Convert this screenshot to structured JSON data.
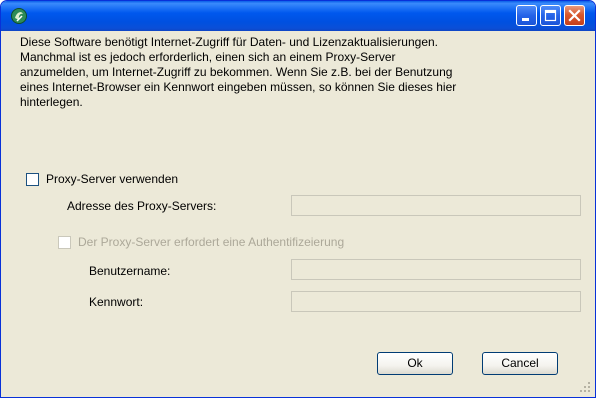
{
  "window": {
    "title": "",
    "controls": {
      "minimize_icon": "minimize-icon",
      "maximize_icon": "maximize-icon",
      "close_icon": "close-icon"
    }
  },
  "intro": {
    "lines": [
      "Diese Software benötigt Internet-Zugriff für Daten- und Lizenzaktualisierungen.",
      "Manchmal ist es jedoch erforderlich, einen sich an einem Proxy-Server",
      "anzumelden, um Internet-Zugriff zu bekommen. Wenn Sie z.B. bei der Benutzung",
      "eines Internet-Browser ein Kennwort eingeben müssen, so können Sie dieses hier",
      "hinterlegen."
    ]
  },
  "proxy": {
    "use_label": "Proxy-Server verwenden",
    "use_checked": false,
    "address_label": "Adresse des Proxy-Servers:",
    "address_value": "",
    "auth_label": "Der Proxy-Server erfordert eine Authentifizeierung",
    "auth_checked": false,
    "username_label": "Benutzername:",
    "username_value": "",
    "password_label": "Kennwort:",
    "password_value": ""
  },
  "buttons": {
    "ok_label": "Ok",
    "cancel_label": "Cancel"
  },
  "colors": {
    "titlebar": "#0058ee",
    "dialog_background": "#ece9d8",
    "close_button": "#d8582e",
    "disabled_text": "#aca899"
  }
}
